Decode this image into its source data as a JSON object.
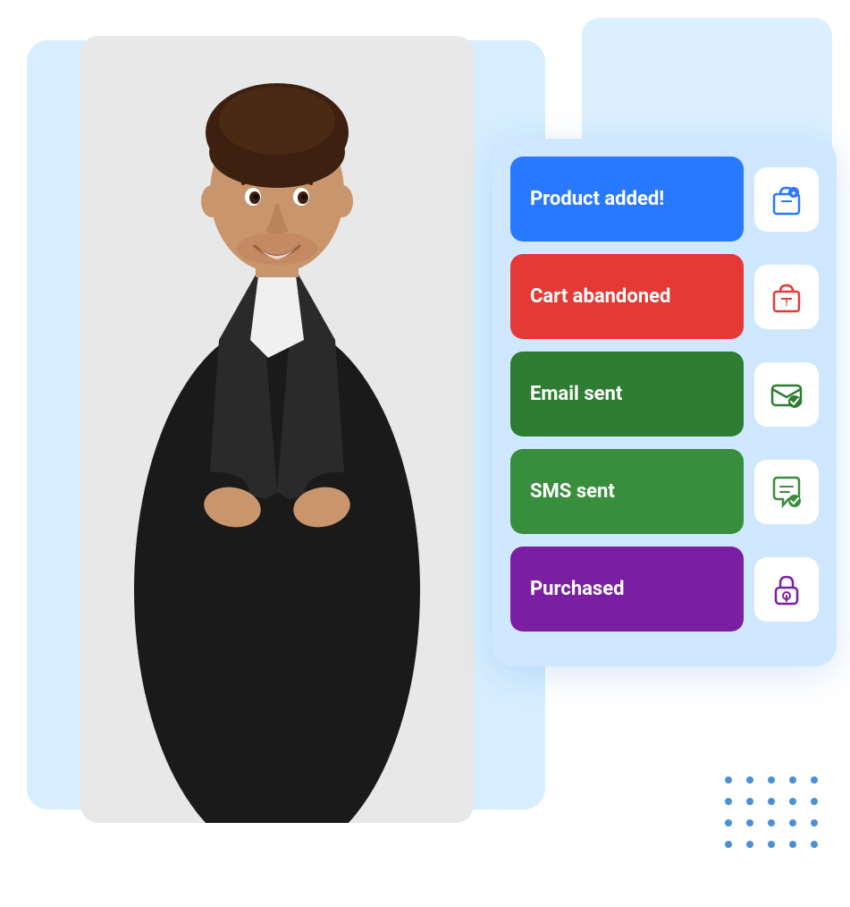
{
  "background": {
    "main_rect_color": "#d6eeff",
    "top_right_rect_color": "#cce8ff"
  },
  "card": {
    "background_color": "#cfe8ff",
    "rows": [
      {
        "id": "product-added",
        "label": "Product added!",
        "label_color": "blue",
        "label_hex": "#2979FF",
        "icon_name": "shop-icon",
        "icon_color": "#2979FF"
      },
      {
        "id": "cart-abandoned",
        "label": "Cart abandoned",
        "label_color": "red",
        "label_hex": "#E53935",
        "icon_name": "shop-cart-icon",
        "icon_color": "#E53935"
      },
      {
        "id": "email-sent",
        "label": "Email sent",
        "label_color": "green",
        "label_hex": "#2E7D32",
        "icon_name": "email-check-icon",
        "icon_color": "#2E7D32"
      },
      {
        "id": "sms-sent",
        "label": "SMS sent",
        "label_color": "green",
        "label_hex": "#388E3C",
        "icon_name": "sms-icon",
        "icon_color": "#388E3C"
      },
      {
        "id": "purchased",
        "label": "Purchased",
        "label_color": "purple",
        "label_hex": "#7B1FA2",
        "icon_name": "lock-purchase-icon",
        "icon_color": "#7B1FA2"
      }
    ]
  },
  "dots": {
    "color": "#4a90d9",
    "count": 20
  }
}
